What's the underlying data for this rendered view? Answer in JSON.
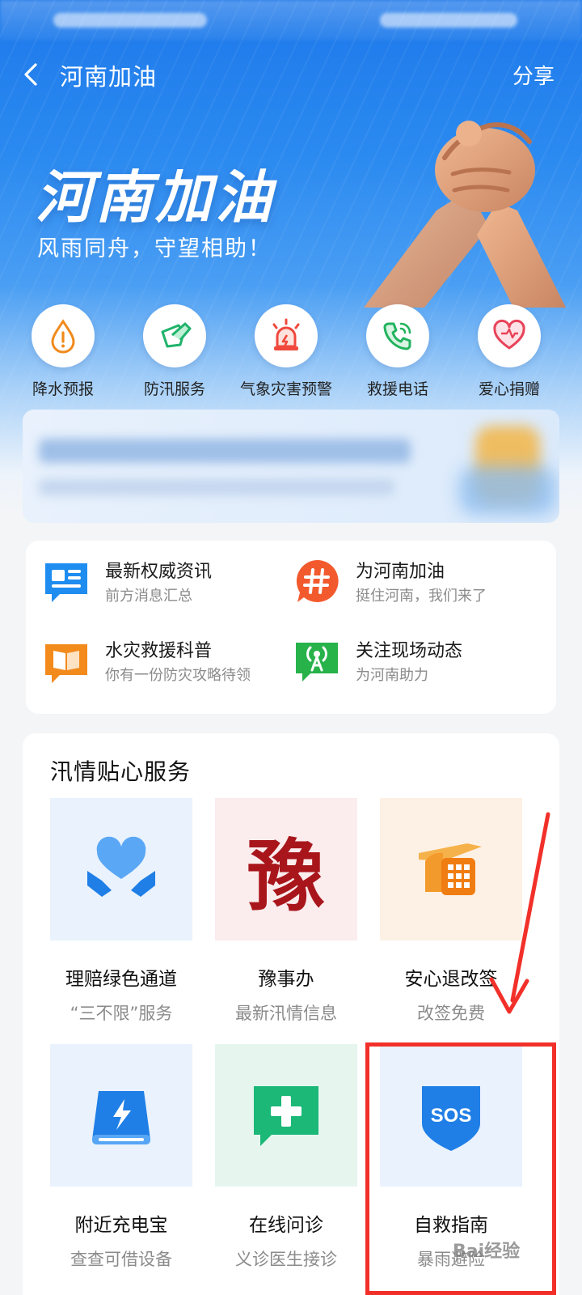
{
  "nav": {
    "title": "河南加油",
    "share_label": "分享"
  },
  "hero": {
    "title": "河南加油",
    "subtitle": "风雨同舟，守望相助！"
  },
  "quick_actions": [
    {
      "label": "降水预报",
      "icon": "raindrop-warning-icon",
      "color": "#f08a1c"
    },
    {
      "label": "防汛服务",
      "icon": "flood-service-icon",
      "color": "#1fb36b"
    },
    {
      "label": "气象灾害预警",
      "icon": "alarm-light-icon",
      "color": "#f0483c"
    },
    {
      "label": "救援电话",
      "icon": "phone-icon",
      "color": "#22b35e"
    },
    {
      "label": "爱心捐赠",
      "icon": "heart-icon",
      "color": "#e8435a"
    }
  ],
  "news": [
    {
      "title": "最新权威资讯",
      "subtitle": "前方消息汇总",
      "icon": "newspaper-icon",
      "color": "#1f8df0"
    },
    {
      "title": "为河南加油",
      "subtitle": "挺住河南，我们来了",
      "icon": "hashtag-icon",
      "color": "#f25a2e"
    },
    {
      "title": "水灾救援科普",
      "subtitle": "你有一份防灾攻略待领",
      "icon": "book-icon",
      "color": "#f28a1c"
    },
    {
      "title": "关注现场动态",
      "subtitle": "为河南助力",
      "icon": "broadcast-icon",
      "color": "#27b24a"
    }
  ],
  "services": {
    "title": "汛情贴心服务",
    "items": [
      {
        "title": "理赔绿色通道",
        "subtitle": "“三不限”服务",
        "icon": "heart-hands-icon",
        "bg": "#e9f2fd"
      },
      {
        "title": "豫事办",
        "subtitle": "最新汛情信息",
        "icon": "yu-seal-icon",
        "bg": "#fbeced",
        "glyph": "豫"
      },
      {
        "title": "安心退改签",
        "subtitle": "改签免费",
        "icon": "building-plane-icon",
        "bg": "#fdf1e5"
      },
      {
        "title": "附近充电宝",
        "subtitle": "查查可借设备",
        "icon": "power-bank-icon",
        "bg": "#e9f2fd"
      },
      {
        "title": "在线问诊",
        "subtitle": "义诊医生接诊",
        "icon": "medical-chat-icon",
        "bg": "#e6f6ef"
      },
      {
        "title": "自救指南",
        "subtitle": "暴雨避险",
        "icon": "sos-shield-icon",
        "bg": "#e9f2fd",
        "badge": "SOS"
      }
    ]
  },
  "watermark": "Bai经验"
}
